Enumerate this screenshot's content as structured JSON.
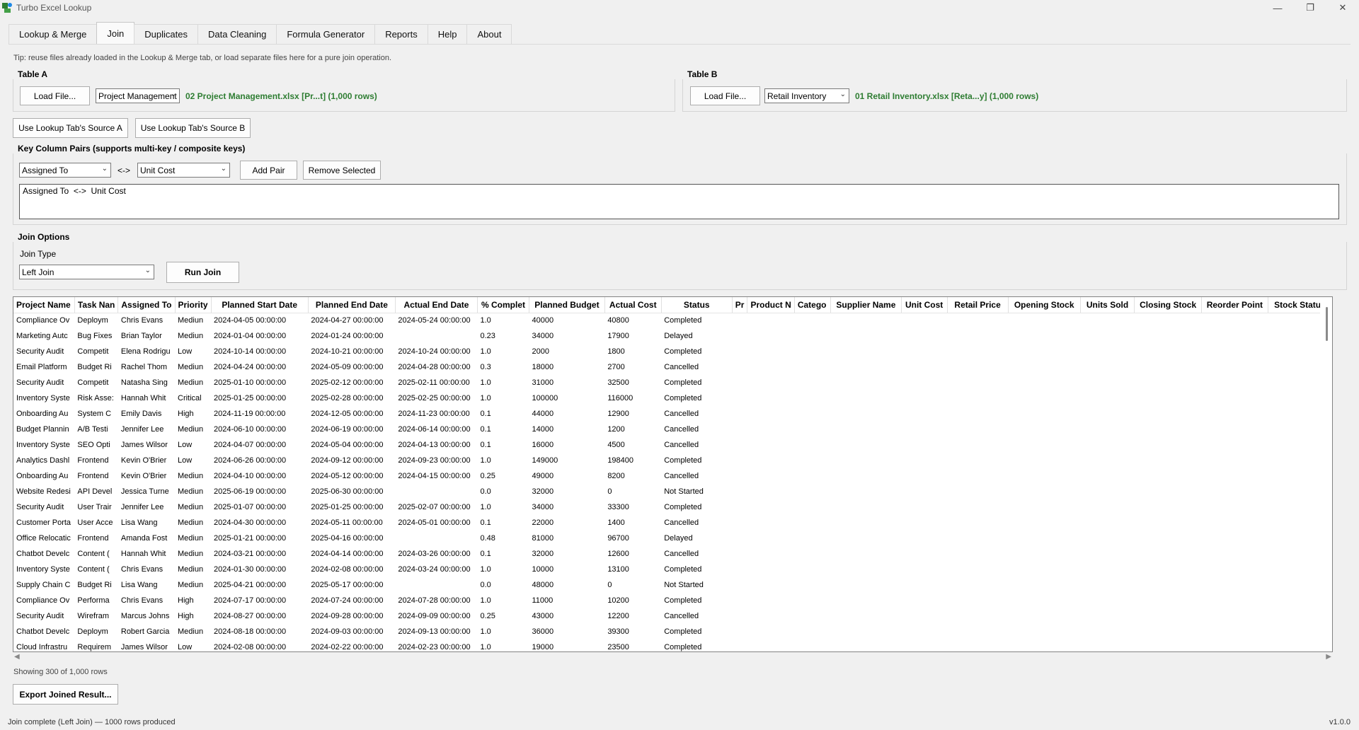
{
  "window": {
    "title": "Turbo Excel Lookup"
  },
  "tabs": [
    {
      "label": "Lookup & Merge",
      "active": false
    },
    {
      "label": "Join",
      "active": true
    },
    {
      "label": "Duplicates",
      "active": false
    },
    {
      "label": "Data Cleaning",
      "active": false
    },
    {
      "label": "Formula Generator",
      "active": false
    },
    {
      "label": "Reports",
      "active": false
    },
    {
      "label": "Help",
      "active": false
    },
    {
      "label": "About",
      "active": false
    }
  ],
  "tip": "Tip: reuse files already loaded in the Lookup & Merge tab, or load separate files here for a pure join operation.",
  "table_a": {
    "title": "Table A",
    "load_label": "Load File...",
    "sheet": "Project Management",
    "file_info": "02 Project Management.xlsx  [Pr...t]  (1,000 rows)"
  },
  "table_b": {
    "title": "Table B",
    "load_label": "Load File...",
    "sheet": "Retail Inventory",
    "file_info": "01 Retail Inventory.xlsx  [Reta...y]  (1,000 rows)"
  },
  "use_source_a": "Use Lookup Tab's Source A",
  "use_source_b": "Use Lookup Tab's Source B",
  "key_pairs": {
    "title": "Key Column Pairs  (supports multi-key / composite keys)",
    "left_column": "Assigned To",
    "separator": "<->",
    "right_column": "Unit Cost",
    "add_label": "Add Pair",
    "remove_label": "Remove Selected",
    "pairs": [
      "Assigned To  <->  Unit Cost"
    ]
  },
  "join_options": {
    "title": "Join Options",
    "type_label": "Join Type",
    "type_value": "Left Join",
    "run_label": "Run Join"
  },
  "grid": {
    "columns": [
      "Project Name",
      "Task Nan",
      "Assigned To",
      "Priority",
      "Planned Start Date",
      "Planned End Date",
      "Actual End Date",
      "% Complet",
      "Planned Budget",
      "Actual Cost",
      "Status",
      "Pr",
      "Product N",
      "Catego",
      "Supplier Name",
      "Unit Cost",
      "Retail Price",
      "Opening Stock",
      "Units Sold",
      "Closing Stock",
      "Reorder Point",
      "Stock Status"
    ],
    "rows": [
      [
        "Compliance Ov",
        "Deploym",
        "Chris Evans",
        "Mediun",
        "2024-04-05 00:00:00",
        "2024-04-27 00:00:00",
        "2024-05-24 00:00:00",
        "1.0",
        "40000",
        "40800",
        "Completed"
      ],
      [
        "Marketing Autc",
        "Bug Fixes",
        "Brian Taylor",
        "Mediun",
        "2024-01-04 00:00:00",
        "2024-01-24 00:00:00",
        "",
        "0.23",
        "34000",
        "17900",
        "Delayed"
      ],
      [
        "Security Audit",
        "Competit",
        "Elena Rodrigu",
        "Low",
        "2024-10-14 00:00:00",
        "2024-10-21 00:00:00",
        "2024-10-24 00:00:00",
        "1.0",
        "2000",
        "1800",
        "Completed"
      ],
      [
        "Email Platform",
        "Budget Ri",
        "Rachel Thom",
        "Mediun",
        "2024-04-24 00:00:00",
        "2024-05-09 00:00:00",
        "2024-04-28 00:00:00",
        "0.3",
        "18000",
        "2700",
        "Cancelled"
      ],
      [
        "Security Audit",
        "Competit",
        "Natasha Sing",
        "Mediun",
        "2025-01-10 00:00:00",
        "2025-02-12 00:00:00",
        "2025-02-11 00:00:00",
        "1.0",
        "31000",
        "32500",
        "Completed"
      ],
      [
        "Inventory Syste",
        "Risk Asse:",
        "Hannah Whit",
        "Critical",
        "2025-01-25 00:00:00",
        "2025-02-28 00:00:00",
        "2025-02-25 00:00:00",
        "1.0",
        "100000",
        "116000",
        "Completed"
      ],
      [
        "Onboarding Au",
        "System C",
        "Emily Davis",
        "High",
        "2024-11-19 00:00:00",
        "2024-12-05 00:00:00",
        "2024-11-23 00:00:00",
        "0.1",
        "44000",
        "12900",
        "Cancelled"
      ],
      [
        "Budget Plannin",
        "A/B Testi",
        "Jennifer Lee",
        "Mediun",
        "2024-06-10 00:00:00",
        "2024-06-19 00:00:00",
        "2024-06-14 00:00:00",
        "0.1",
        "14000",
        "1200",
        "Cancelled"
      ],
      [
        "Inventory Syste",
        "SEO Opti",
        "James Wilsor",
        "Low",
        "2024-04-07 00:00:00",
        "2024-05-04 00:00:00",
        "2024-04-13 00:00:00",
        "0.1",
        "16000",
        "4500",
        "Cancelled"
      ],
      [
        "Analytics Dashl",
        "Frontend",
        "Kevin O'Brier",
        "Low",
        "2024-06-26 00:00:00",
        "2024-09-12 00:00:00",
        "2024-09-23 00:00:00",
        "1.0",
        "149000",
        "198400",
        "Completed"
      ],
      [
        "Onboarding Au",
        "Frontend",
        "Kevin O'Brier",
        "Mediun",
        "2024-04-10 00:00:00",
        "2024-05-12 00:00:00",
        "2024-04-15 00:00:00",
        "0.25",
        "49000",
        "8200",
        "Cancelled"
      ],
      [
        "Website Redesi",
        "API Devel",
        "Jessica Turne",
        "Mediun",
        "2025-06-19 00:00:00",
        "2025-06-30 00:00:00",
        "",
        "0.0",
        "32000",
        "0",
        "Not Started"
      ],
      [
        "Security Audit",
        "User Trair",
        "Jennifer Lee",
        "Mediun",
        "2025-01-07 00:00:00",
        "2025-01-25 00:00:00",
        "2025-02-07 00:00:00",
        "1.0",
        "34000",
        "33300",
        "Completed"
      ],
      [
        "Customer Porta",
        "User Acce",
        "Lisa Wang",
        "Mediun",
        "2024-04-30 00:00:00",
        "2024-05-11 00:00:00",
        "2024-05-01 00:00:00",
        "0.1",
        "22000",
        "1400",
        "Cancelled"
      ],
      [
        "Office Relocatic",
        "Frontend",
        "Amanda Fost",
        "Mediun",
        "2025-01-21 00:00:00",
        "2025-04-16 00:00:00",
        "",
        "0.48",
        "81000",
        "96700",
        "Delayed"
      ],
      [
        "Chatbot Develc",
        "Content (",
        "Hannah Whit",
        "Mediun",
        "2024-03-21 00:00:00",
        "2024-04-14 00:00:00",
        "2024-03-26 00:00:00",
        "0.1",
        "32000",
        "12600",
        "Cancelled"
      ],
      [
        "Inventory Syste",
        "Content (",
        "Chris Evans",
        "Mediun",
        "2024-01-30 00:00:00",
        "2024-02-08 00:00:00",
        "2024-03-24 00:00:00",
        "1.0",
        "10000",
        "13100",
        "Completed"
      ],
      [
        "Supply Chain C",
        "Budget Ri",
        "Lisa Wang",
        "Mediun",
        "2025-04-21 00:00:00",
        "2025-05-17 00:00:00",
        "",
        "0.0",
        "48000",
        "0",
        "Not Started"
      ],
      [
        "Compliance Ov",
        "Performa",
        "Chris Evans",
        "High",
        "2024-07-17 00:00:00",
        "2024-07-24 00:00:00",
        "2024-07-28 00:00:00",
        "1.0",
        "11000",
        "10200",
        "Completed"
      ],
      [
        "Security Audit",
        "Wirefram",
        "Marcus Johns",
        "High",
        "2024-08-27 00:00:00",
        "2024-09-28 00:00:00",
        "2024-09-09 00:00:00",
        "0.25",
        "43000",
        "12200",
        "Cancelled"
      ],
      [
        "Chatbot Develc",
        "Deploym",
        "Robert Garcia",
        "Mediun",
        "2024-08-18 00:00:00",
        "2024-09-03 00:00:00",
        "2024-09-13 00:00:00",
        "1.0",
        "36000",
        "39300",
        "Completed"
      ],
      [
        "Cloud Infrastru",
        "Requirem",
        "James Wilsor",
        "Low",
        "2024-02-08 00:00:00",
        "2024-02-22 00:00:00",
        "2024-02-23 00:00:00",
        "1.0",
        "19000",
        "23500",
        "Completed"
      ]
    ]
  },
  "showing": "Showing 300 of 1,000 rows",
  "export_label": "Export Joined Result...",
  "status_text": "Join complete (Left Join) — 1000 rows produced",
  "version": "v1.0.0"
}
